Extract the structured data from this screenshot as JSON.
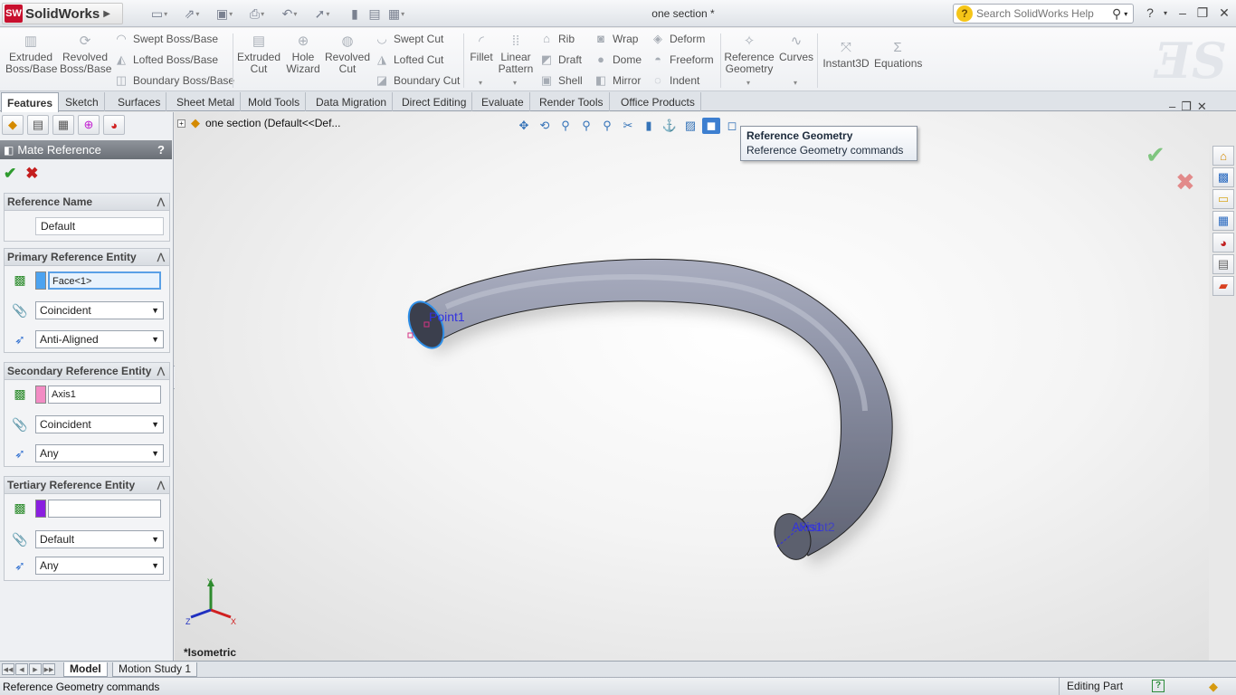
{
  "app": {
    "name": "SolidWorks",
    "logo_mark": "SW",
    "document_title": "one section *"
  },
  "help_search": {
    "placeholder": "Search SolidWorks Help"
  },
  "command_manager": {
    "features": [
      {
        "id": "extruded-boss",
        "label": "Extruded\nBoss/Base",
        "icon": "extrude-icon"
      },
      {
        "id": "revolved-boss",
        "label": "Revolved\nBoss/Base",
        "icon": "revolve-icon"
      }
    ],
    "boss_small": [
      "Swept Boss/Base",
      "Lofted Boss/Base",
      "Boundary Boss/Base"
    ],
    "cut_big": [
      {
        "id": "extruded-cut",
        "label": "Extruded\nCut"
      },
      {
        "id": "hole-wizard",
        "label": "Hole\nWizard"
      },
      {
        "id": "revolved-cut",
        "label": "Revolved\nCut"
      }
    ],
    "cut_small": [
      "Swept Cut",
      "Lofted Cut",
      "Boundary Cut"
    ],
    "fillet": "Fillet",
    "linear_pattern": "Linear\nPattern",
    "col1": [
      "Rib",
      "Draft",
      "Shell"
    ],
    "col2": [
      "Wrap",
      "Dome",
      "Mirror"
    ],
    "col3": [
      "Deform",
      "Freeform",
      "Indent"
    ],
    "reference_geometry": "Reference\nGeometry",
    "curves": "Curves",
    "instant3d": "Instant3D",
    "equations": "Equations"
  },
  "tabs": [
    "Features",
    "Sketch",
    "Surfaces",
    "Sheet Metal",
    "Mold Tools",
    "Data Migration",
    "Direct Editing",
    "Evaluate",
    "Render Tools",
    "Office Products"
  ],
  "property_manager": {
    "title": "Mate Reference",
    "help": "?",
    "reference_name": {
      "header": "Reference Name",
      "value": "Default"
    },
    "primary": {
      "header": "Primary Reference Entity",
      "entity": "Face<1>",
      "swatch_color": "#4da3f0",
      "mate_type": "Coincident",
      "alignment": "Anti-Aligned"
    },
    "secondary": {
      "header": "Secondary Reference Entity",
      "entity": "Axis1",
      "swatch_color": "#f28cc4",
      "mate_type": "Coincident",
      "alignment": "Any"
    },
    "tertiary": {
      "header": "Tertiary Reference Entity",
      "entity": "",
      "swatch_color": "#8a1fe0",
      "mate_type": "Default",
      "alignment": "Any"
    }
  },
  "viewport": {
    "tree_node": "one section  (Default<<Def...",
    "view_label": "*Isometric",
    "point_label": "Point1",
    "axis_label": "Axis1",
    "point2_label": "Point2",
    "triad": {
      "x": "X",
      "y": "Y",
      "z": "Z"
    },
    "part_color": "#8b90a4"
  },
  "tooltip": {
    "title": "Reference Geometry",
    "description": "Reference Geometry commands"
  },
  "bottom_tabs": [
    "Model",
    "Motion Study 1"
  ],
  "status": {
    "message": "Reference Geometry commands",
    "mode": "Editing Part",
    "quick_help": "?"
  }
}
